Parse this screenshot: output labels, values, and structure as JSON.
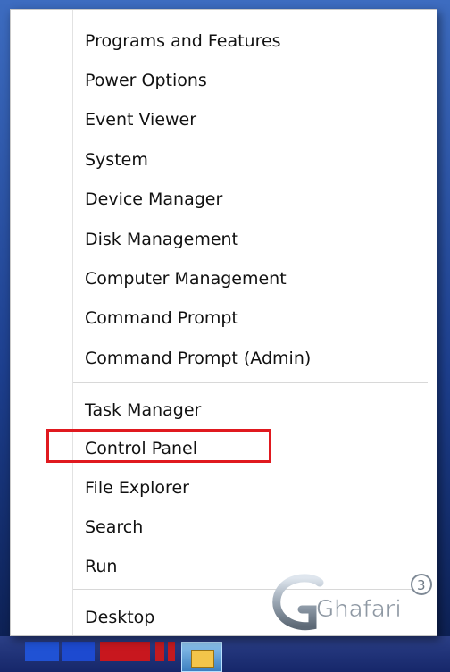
{
  "menu": {
    "group1": [
      "Programs and Features",
      "Power Options",
      "Event Viewer",
      "System",
      "Device Manager",
      "Disk Management",
      "Computer Management",
      "Command Prompt",
      "Command Prompt (Admin)"
    ],
    "group2": [
      "Task Manager",
      "Control Panel",
      "File Explorer",
      "Search",
      "Run"
    ],
    "group3": [
      "Desktop"
    ]
  },
  "watermark": {
    "text": "Ghafari",
    "superscript": "3"
  },
  "colors": {
    "highlight": "#e0191f",
    "menu_bg": "#ffffff",
    "text": "#111111"
  }
}
